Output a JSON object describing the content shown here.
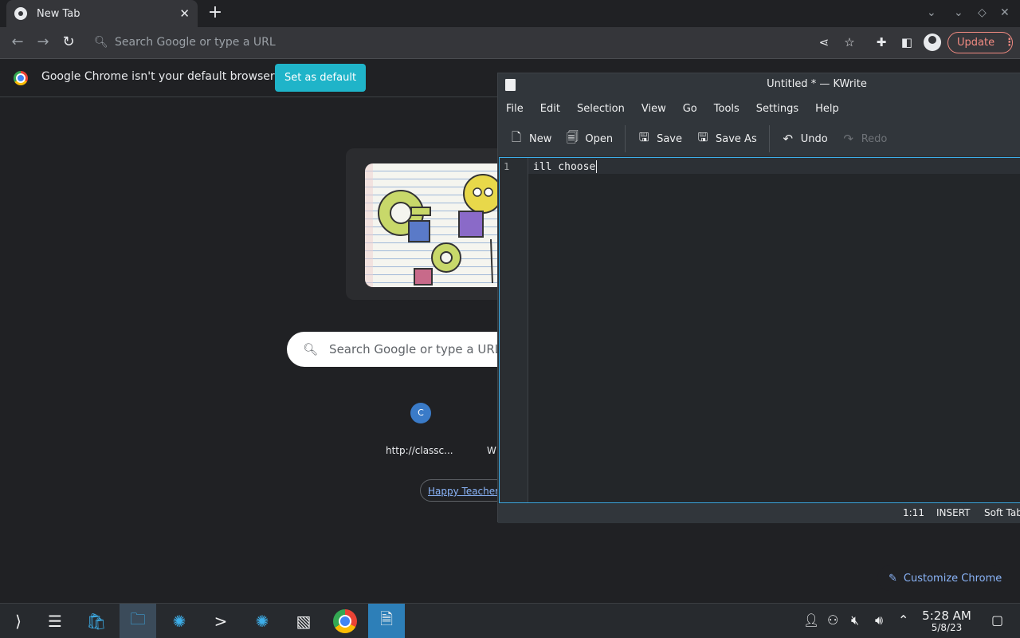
{
  "browser": {
    "tab_title": "New Tab",
    "omnibox_placeholder": "Search Google or type a URL",
    "update_label": "Update",
    "infobar_text": "Google Chrome isn't your default browser",
    "set_default_label": "Set as default"
  },
  "ntp": {
    "search_placeholder": "Search Google or type a URL",
    "tiles": [
      {
        "letter": "C",
        "label": "http://classc..."
      },
      {
        "label": "W"
      }
    ],
    "promo_link": "Happy Teacher A",
    "customize_label": "Customize Chrome"
  },
  "kwrite": {
    "title": "Untitled * — KWrite",
    "menu": [
      "File",
      "Edit",
      "Selection",
      "View",
      "Go",
      "Tools",
      "Settings",
      "Help"
    ],
    "toolbar": {
      "new": "New",
      "open": "Open",
      "save": "Save",
      "save_as": "Save As",
      "undo": "Undo",
      "redo": "Redo"
    },
    "line_number": "1",
    "text": "ill choose",
    "status": {
      "position": "1:11",
      "mode": "INSERT",
      "tabs": "Soft Tab"
    }
  },
  "taskbar": {
    "time": "5:28 AM",
    "date": "5/8/23"
  },
  "colors": {
    "accent": "#3daee9",
    "set_default_bg": "#1fb4c9",
    "update_border": "#f28b82",
    "link": "#8ab4f8"
  },
  "icons": [
    "back-icon",
    "forward-icon",
    "reload-icon",
    "share-icon",
    "star-icon",
    "extensions-icon",
    "sidepanel-icon",
    "profile-icon",
    "menu-dots-icon",
    "pencil-icon"
  ]
}
